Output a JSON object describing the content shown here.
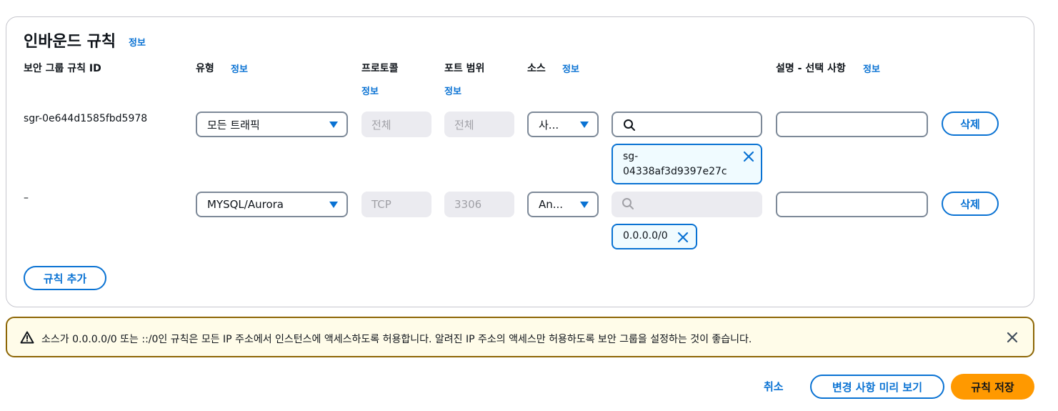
{
  "panel": {
    "title": "인바운드 규칙",
    "title_info": "정보"
  },
  "headers": {
    "rule_id": "보안 그룹 규칙 ID",
    "type": "유형",
    "type_info": "정보",
    "protocol": "프로토콜",
    "protocol_info": "정보",
    "port_range": "포트 범위",
    "port_info": "정보",
    "source": "소스",
    "source_info": "정보",
    "description": "설명 - 선택 사항",
    "description_info": "정보"
  },
  "rows": [
    {
      "rule_id": "sgr-0e644d1585fbd5978",
      "type": "모든 트래픽",
      "protocol": "전체",
      "port_range": "전체",
      "source_type": "사...",
      "search_value": "",
      "token_line1": "sg-",
      "token_line2": "04338af3d9397e27c",
      "description": "",
      "delete_label": "삭제"
    },
    {
      "rule_id": "–",
      "type": "MYSQL/Aurora",
      "protocol": "TCP",
      "port_range": "3306",
      "source_type": "An...",
      "search_value": "",
      "token_value": "0.0.0.0/0",
      "description": "",
      "delete_label": "삭제"
    }
  ],
  "add_rule_label": "규칙 추가",
  "alert": {
    "text": "소스가 0.0.0.0/0 또는 ::/0인 규칙은 모든 IP 주소에서 인스턴스에 액세스하도록 허용합니다. 알려진 IP 주소의 액세스만 허용하도록 보안 그룹을 설정하는 것이 좋습니다.",
    "icon": "warning-icon"
  },
  "footer": {
    "cancel": "취소",
    "preview": "변경 사항 미리 보기",
    "save": "규칙 저장"
  },
  "colors": {
    "accent": "#0972d3",
    "primary_button": "#ff9900",
    "warning_border": "#8d6605",
    "warning_bg": "#fffce9"
  }
}
